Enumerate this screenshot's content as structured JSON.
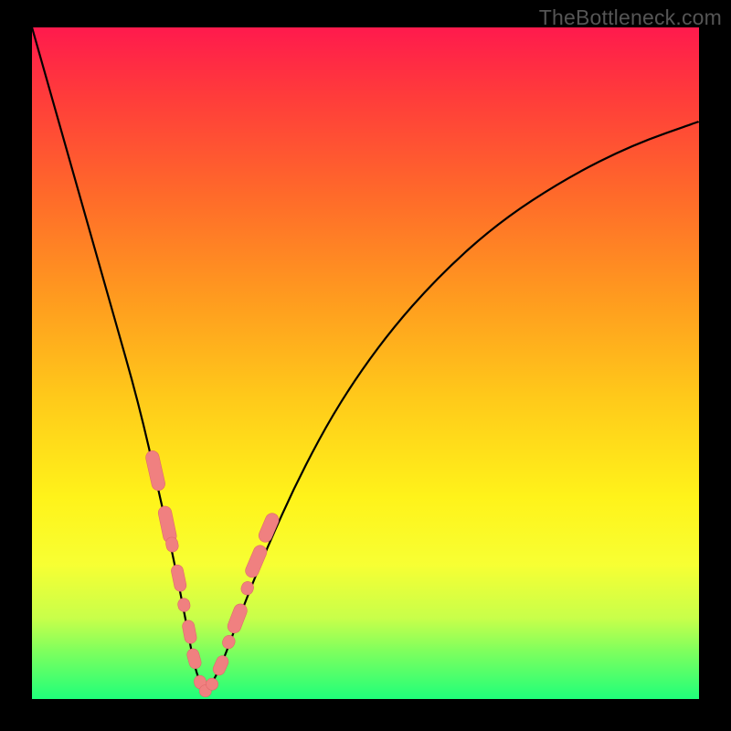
{
  "watermark": "TheBottleneck.com",
  "colors": {
    "frame": "#000000",
    "curve": "#000000",
    "marker_fill": "#f08080",
    "marker_stroke": "#e06a6a"
  },
  "chart_data": {
    "type": "line",
    "title": "",
    "xlabel": "",
    "ylabel": "",
    "xlim": [
      0,
      100
    ],
    "ylim": [
      0,
      100
    ],
    "grid": false,
    "series": [
      {
        "name": "bottleneck-curve",
        "x": [
          0,
          4,
          8,
          12,
          16,
          19,
          21,
          23,
          24.5,
          26,
          28,
          31,
          35,
          40,
          46,
          53,
          61,
          70,
          80,
          90,
          100
        ],
        "y": [
          100,
          86,
          72,
          58,
          44,
          31,
          22,
          12,
          4,
          1,
          4,
          12,
          22,
          33,
          44,
          54,
          63,
          71,
          77.5,
          82.5,
          86
        ]
      }
    ],
    "markers": [
      {
        "x": 18.5,
        "y": 34,
        "w": 2.0,
        "h": 6.0
      },
      {
        "x": 20.3,
        "y": 26,
        "w": 2.0,
        "h": 5.5
      },
      {
        "x": 21.0,
        "y": 23,
        "w": 1.8,
        "h": 2.2
      },
      {
        "x": 22.0,
        "y": 18,
        "w": 1.8,
        "h": 4.0
      },
      {
        "x": 22.8,
        "y": 14,
        "w": 1.8,
        "h": 2.0
      },
      {
        "x": 23.6,
        "y": 10,
        "w": 1.8,
        "h": 3.5
      },
      {
        "x": 24.3,
        "y": 6,
        "w": 1.8,
        "h": 3.0
      },
      {
        "x": 25.2,
        "y": 2.5,
        "w": 1.8,
        "h": 2.0
      },
      {
        "x": 26.0,
        "y": 1.2,
        "w": 1.8,
        "h": 1.8
      },
      {
        "x": 27.0,
        "y": 2.2,
        "w": 1.8,
        "h": 1.8
      },
      {
        "x": 28.3,
        "y": 5.0,
        "w": 1.8,
        "h": 3.0
      },
      {
        "x": 29.5,
        "y": 8.5,
        "w": 1.8,
        "h": 2.0
      },
      {
        "x": 30.8,
        "y": 12,
        "w": 2.0,
        "h": 4.5
      },
      {
        "x": 32.3,
        "y": 16.5,
        "w": 1.8,
        "h": 2.0
      },
      {
        "x": 33.6,
        "y": 20.5,
        "w": 2.0,
        "h": 5.0
      },
      {
        "x": 35.5,
        "y": 25.5,
        "w": 2.0,
        "h": 4.5
      }
    ]
  }
}
